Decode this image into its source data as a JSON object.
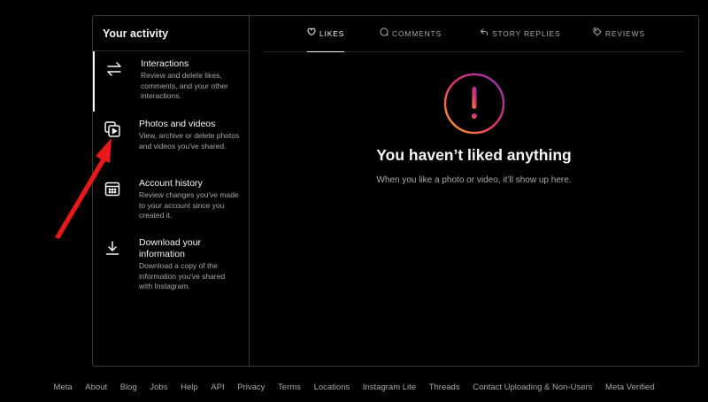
{
  "sidebar": {
    "title": "Your activity",
    "items": [
      {
        "label": "Interactions",
        "desc": "Review and delete likes, comments, and your other interactions.",
        "icon": "arrows-swap-icon",
        "active": true
      },
      {
        "label": "Photos and videos",
        "desc": "View, archive or delete photos and videos you've shared.",
        "icon": "media-icon"
      },
      {
        "label": "Account history",
        "desc": "Review changes you've made to your account since you created it.",
        "icon": "calendar-icon"
      },
      {
        "label": "Download your information",
        "desc": "Download a copy of the information you've shared with Instagram.",
        "icon": "download-icon"
      }
    ]
  },
  "tabs": [
    {
      "label": "LIKES",
      "icon": "heart-icon",
      "active": true
    },
    {
      "label": "COMMENTS",
      "icon": "comment-icon"
    },
    {
      "label": "STORY REPLIES",
      "icon": "reply-icon"
    },
    {
      "label": "REVIEWS",
      "icon": "tag-icon"
    }
  ],
  "empty_state": {
    "icon": "alert-icon",
    "title": "You haven’t liked anything",
    "subtitle": "When you like a photo or video, it’ll show up here."
  },
  "footer": {
    "links": [
      "Meta",
      "About",
      "Blog",
      "Jobs",
      "Help",
      "API",
      "Privacy",
      "Terms",
      "Locations",
      "Instagram Lite",
      "Threads",
      "Contact Uploading & Non-Users",
      "Meta Verified"
    ]
  },
  "colors": {
    "background": "#000000",
    "text_primary": "#f5f5f5",
    "text_secondary": "#a8a8a8",
    "border": "#363636",
    "annotation_arrow": "#e8191a",
    "gradient": [
      "#f9a825",
      "#e1306c",
      "#833ab4"
    ]
  }
}
